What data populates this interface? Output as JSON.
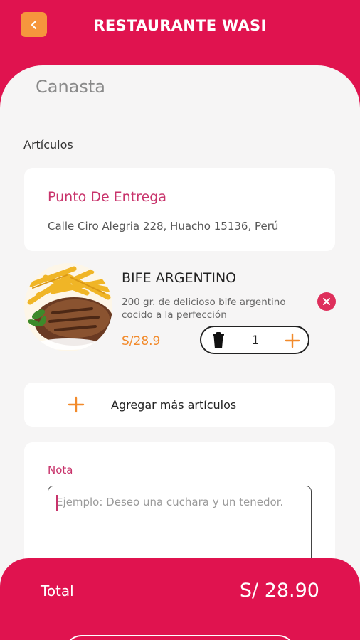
{
  "header": {
    "title": "RESTAURANTE WASI",
    "back_icon": "chevron-left-icon",
    "back_color": "#f6963d"
  },
  "page": {
    "title": "Canasta",
    "section_label": "Artículos"
  },
  "delivery": {
    "title": "Punto De Entrega",
    "address": "Calle Ciro Alegria 228, Huacho 15136, Perú"
  },
  "cart_item": {
    "name": "BIFE ARGENTINO",
    "description": "200 gr. de delicioso bife argentino cocido a la perfección",
    "price": "S/28.9",
    "quantity": "1",
    "image_icon": "steak-with-fries-image",
    "remove_icon": "close-icon",
    "trash_icon": "trash-icon",
    "plus_icon": "plus-icon"
  },
  "add_more": {
    "label": "Agregar más artículos",
    "icon": "plus-icon"
  },
  "note": {
    "label": "Nota",
    "placeholder": "Ejemplo: Deseo una cuchara y un tenedor.",
    "value": ""
  },
  "footer": {
    "total_label": "Total",
    "total_value": "S/ 28.90"
  },
  "colors": {
    "primary": "#e0134f",
    "accent": "#f28a2b",
    "label_pink": "#c8336b",
    "background": "#f6f5f5"
  }
}
